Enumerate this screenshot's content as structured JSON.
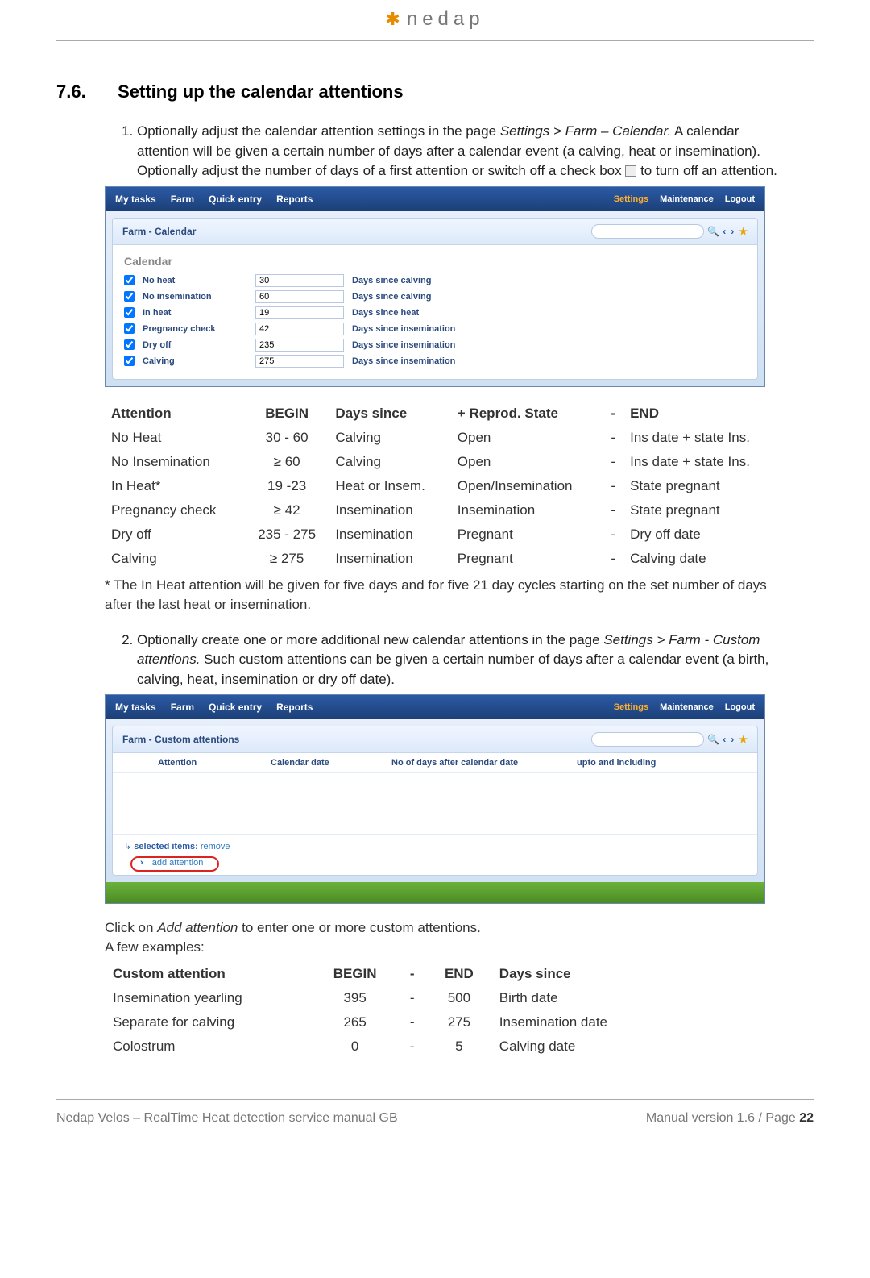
{
  "header": {
    "logo_text": "nedap"
  },
  "section": {
    "number": "7.6.",
    "title": "Setting up the calendar attentions"
  },
  "step1": {
    "prefix": "Optionally adjust the calendar attention settings in the page ",
    "path": "Settings > Farm – Calendar.",
    "body": " A calendar attention will be given a certain number of days after a calendar event (a calving, heat or insemination). Optionally adjust the number of days of a first attention or switch off a check box ",
    "suffix": " to turn off an attention."
  },
  "shot1": {
    "menu": {
      "left": [
        "My tasks",
        "Farm",
        "Quick entry",
        "Reports"
      ],
      "right_active": "Settings",
      "right": [
        "Maintenance",
        "Logout"
      ]
    },
    "panel_title": "Farm - Calendar",
    "section_label": "Calendar",
    "rows": [
      {
        "label": "No heat",
        "value": "30",
        "desc": "Days since calving"
      },
      {
        "label": "No insemination",
        "value": "60",
        "desc": "Days since calving"
      },
      {
        "label": "In heat",
        "value": "19",
        "desc": "Days since heat"
      },
      {
        "label": "Pregnancy check",
        "value": "42",
        "desc": "Days since insemination"
      },
      {
        "label": "Dry off",
        "value": "235",
        "desc": "Days since insemination"
      },
      {
        "label": "Calving",
        "value": "275",
        "desc": "Days since insemination"
      }
    ]
  },
  "att_table": {
    "head": [
      "Attention",
      "BEGIN",
      "Days since",
      "+  Reprod. State",
      "-",
      "END"
    ],
    "rows": [
      [
        "No Heat",
        "30 - 60",
        "Calving",
        "Open",
        "-",
        "Ins date + state Ins."
      ],
      [
        "No Insemination",
        "≥ 60",
        "Calving",
        "Open",
        "-",
        "Ins date + state Ins."
      ],
      [
        "In Heat*",
        "19 -23",
        "Heat or Insem.",
        "Open/Insemination",
        "-",
        "State pregnant"
      ],
      [
        "Pregnancy check",
        "≥ 42",
        "Insemination",
        "Insemination",
        "-",
        "State pregnant"
      ],
      [
        "Dry off",
        "235 - 275",
        "Insemination",
        "Pregnant",
        "-",
        "Dry off date"
      ],
      [
        "Calving",
        "≥ 275",
        "Insemination",
        "Pregnant",
        "-",
        "Calving date"
      ]
    ],
    "note": "* The In Heat attention will be given for five days and for five 21 day cycles starting on the set number of days after the last heat or insemination."
  },
  "step2": {
    "prefix": "Optionally create one or more additional new calendar attentions in the page ",
    "path": "Settings > Farm - Custom attentions.",
    "body": " Such custom attentions can be given a certain number of days after a calendar event (a birth, calving, heat, insemination or dry off date)."
  },
  "shot2": {
    "menu": {
      "left": [
        "My tasks",
        "Farm",
        "Quick entry",
        "Reports"
      ],
      "right_active": "Settings",
      "right": [
        "Maintenance",
        "Logout"
      ]
    },
    "panel_title": "Farm - Custom attentions",
    "cols": [
      "Attention",
      "Calendar date",
      "No of days after calendar date",
      "upto and including"
    ],
    "selected_label": "selected items:",
    "remove_label": "remove",
    "add_label": "add attention"
  },
  "after_shot2": {
    "l1a": "Click on ",
    "l1i": "Add attention",
    "l1b": " to enter one or more custom attentions.",
    "l2": "A few examples:"
  },
  "cust_table": {
    "head": [
      "Custom attention",
      "BEGIN",
      "-",
      "END",
      "Days since"
    ],
    "rows": [
      [
        "Insemination yearling",
        "395",
        "-",
        "500",
        "Birth date"
      ],
      [
        "Separate for calving",
        "265",
        "-",
        "275",
        "Insemination date"
      ],
      [
        "Colostrum",
        "0",
        "-",
        "5",
        "Calving date"
      ]
    ]
  },
  "footer": {
    "left": "Nedap Velos – RealTime Heat detection service manual GB",
    "right_prefix": "Manual version 1.6 / Page ",
    "page": "22"
  }
}
